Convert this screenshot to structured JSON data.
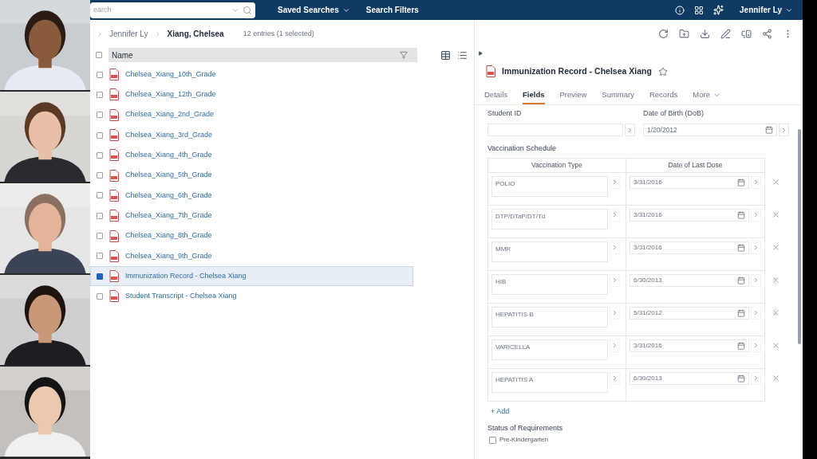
{
  "top_bar": {
    "search": {
      "placeholder": "earch"
    },
    "menus": [
      {
        "label": "Saved Searches",
        "dropdown": true
      },
      {
        "label": "Search Filters",
        "dropdown": false
      }
    ],
    "user": "Jennifer Ly"
  },
  "breadcrumb": [
    "Jennifer Ly",
    "Xiang, Chelsea"
  ],
  "entry_count": "12 entries (1 selected)",
  "list": {
    "column": "Name",
    "select_all_checked": false,
    "rows": [
      {
        "name": "Chelsea_Xiang_10th_Grade",
        "checked": false,
        "selected": false
      },
      {
        "name": "Chelsea_Xiang_12th_Grade",
        "checked": false,
        "selected": false
      },
      {
        "name": "Chelsea_Xiang_2nd_Grade",
        "checked": false,
        "selected": false
      },
      {
        "name": "Chelsea_Xiang_3rd_Grade",
        "checked": false,
        "selected": false
      },
      {
        "name": "Chelsea_Xiang_4th_Grade",
        "checked": false,
        "selected": false
      },
      {
        "name": "Chelsea_Xiang_5th_Grade",
        "checked": false,
        "selected": false
      },
      {
        "name": "Chelsea_Xiang_6th_Grade",
        "checked": false,
        "selected": false
      },
      {
        "name": "Chelsea_Xiang_7th_Grade",
        "checked": false,
        "selected": false
      },
      {
        "name": "Chelsea_Xiang_8th_Grade",
        "checked": false,
        "selected": false
      },
      {
        "name": "Chelsea_Xiang_9th_Grade",
        "checked": false,
        "selected": false
      },
      {
        "name": "Immunization Record - Chelsea Xiang",
        "checked": true,
        "selected": true
      },
      {
        "name": "Student Transcript - Chelsea Xiang",
        "checked": false,
        "selected": false
      }
    ]
  },
  "detail": {
    "title": "Immunization Record - Chelsea Xiang",
    "starred": false,
    "tabs": [
      {
        "label": "Details",
        "selected": false
      },
      {
        "label": "Fields",
        "selected": true
      },
      {
        "label": "Preview",
        "selected": false
      },
      {
        "label": "Summary",
        "selected": false
      },
      {
        "label": "Records",
        "selected": false
      },
      {
        "label": "More",
        "selected": false
      }
    ],
    "student_id": {
      "label": "Student ID"
    },
    "dob": {
      "label": "Date of Birth (DoB)",
      "value": "1/20/2012"
    },
    "vaccination": {
      "title": "Vaccination Schedule",
      "columns": [
        "Vaccination Type",
        "Date of Last Dose"
      ],
      "rows": [
        {
          "type": "POLIO",
          "date": "3/31/2016"
        },
        {
          "type": "DTP/DTaP/DT/Td",
          "date": "3/31/2016"
        },
        {
          "type": "MMR",
          "date": "3/31/2016"
        },
        {
          "type": "HIB",
          "date": "6/30/2013"
        },
        {
          "type": "HEPATITIS B",
          "date": "5/31/2012"
        },
        {
          "type": "VARICELLA",
          "date": "3/31/2016"
        },
        {
          "type": "HEPATITIS A",
          "date": "6/30/2013"
        }
      ]
    },
    "add": "+ Add",
    "status": {
      "title": "Status of Requirements",
      "items": [
        {
          "label": "Pre-Kindergarten",
          "checked": false
        }
      ]
    }
  }
}
